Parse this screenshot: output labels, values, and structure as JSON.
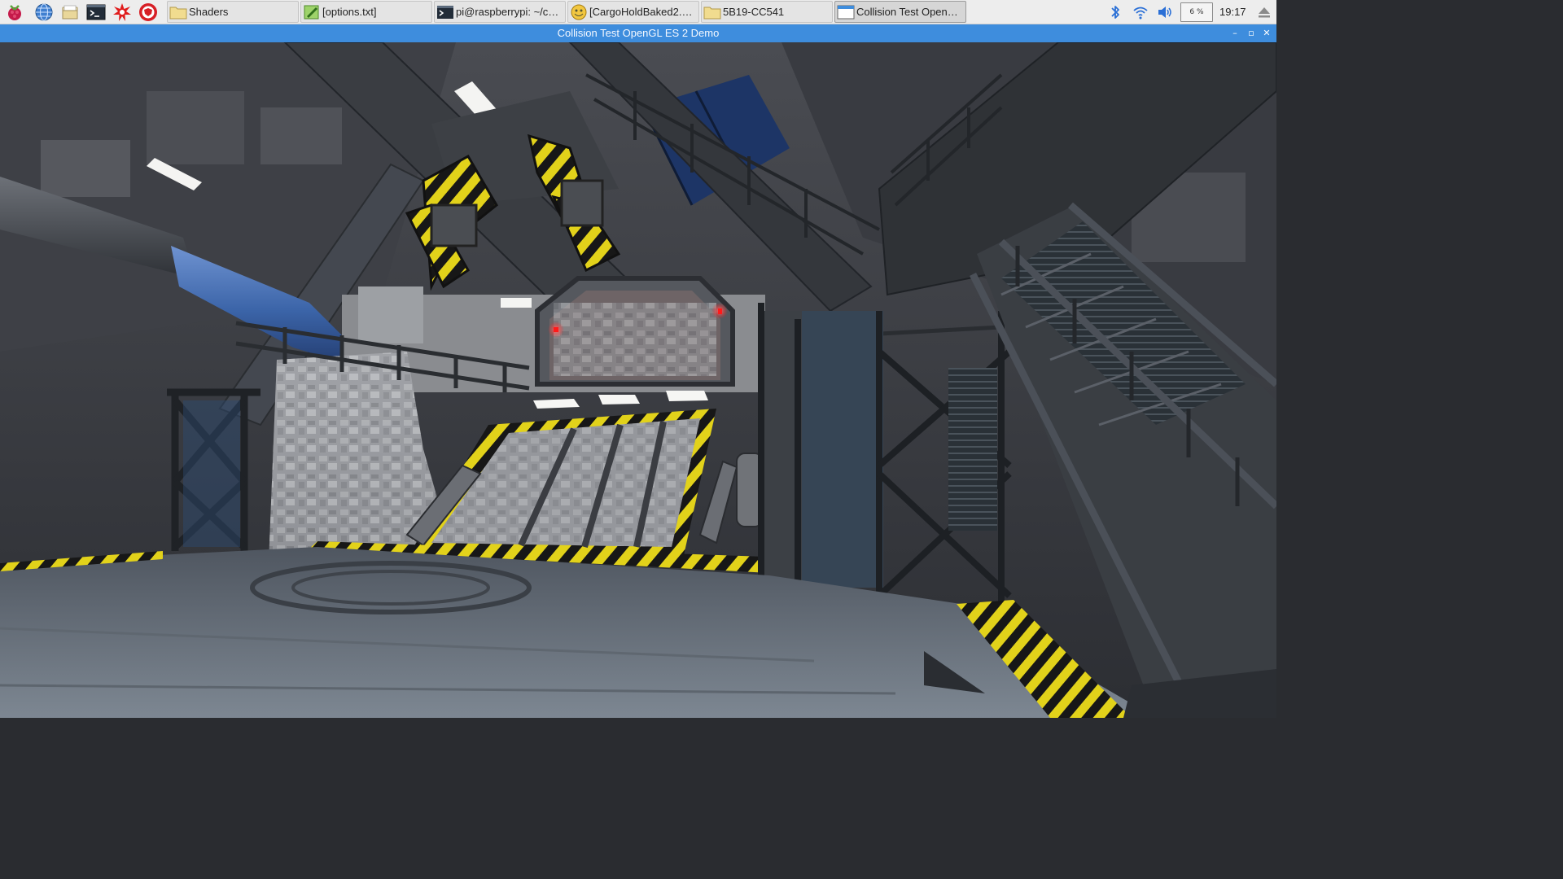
{
  "taskbar": {
    "launchers": [
      {
        "name": "raspberry-menu-icon"
      },
      {
        "name": "web-browser-icon"
      },
      {
        "name": "file-manager-icon"
      },
      {
        "name": "terminal-icon"
      },
      {
        "name": "math-kernel-icon"
      },
      {
        "name": "wolfram-icon"
      }
    ],
    "tasks": [
      {
        "label": "Shaders",
        "icon": "folder-icon"
      },
      {
        "label": "[options.txt]",
        "icon": "text-editor-icon"
      },
      {
        "label": "pi@raspberrypi: ~/co...",
        "icon": "terminal-icon"
      },
      {
        "label": "[CargoHoldBaked2.m...",
        "icon": "image-viewer-icon"
      },
      {
        "label": "5B19-CC541",
        "icon": "folder-icon"
      },
      {
        "label": "Collision Test OpenG...",
        "icon": "window-icon",
        "active": true
      }
    ],
    "tray": {
      "icons": [
        "bluetooth-icon",
        "wifi-icon",
        "volume-icon"
      ],
      "cpu_usage": "6 %",
      "clock": "19:17",
      "eject_icon": "eject-icon"
    }
  },
  "window": {
    "title": "Collision Test OpenGL ES 2 Demo",
    "controls": {
      "minimize": "–",
      "maximize": "▫",
      "close": "✕"
    }
  },
  "colors": {
    "titlebar": "#3e8ddd",
    "taskbar": "#ededed",
    "hazard_yellow": "#e2d21a",
    "pipe_blue": "#3b64a8"
  }
}
